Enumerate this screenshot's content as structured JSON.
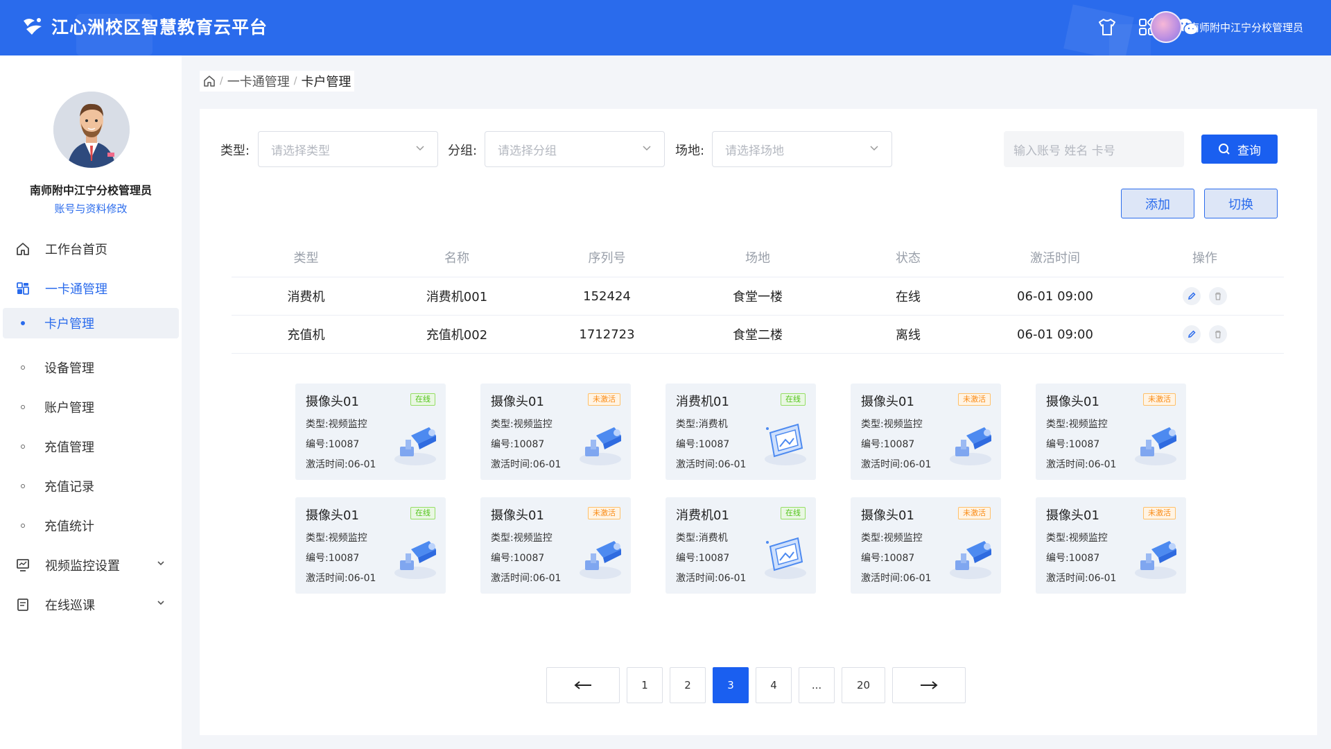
{
  "app": {
    "title": "江心洲校区智慧教育云平台"
  },
  "header": {
    "icons": [
      "tshirt-icon",
      "apps-grid-icon",
      "wechat-icon"
    ],
    "user_name": "南师附中江宁分校管理员"
  },
  "sidebar": {
    "profile_name": "南师附中江宁分校管理员",
    "profile_link": "账号与资料修改",
    "menu": [
      {
        "label": "工作台首页",
        "icon": "home-icon"
      },
      {
        "label": "一卡通管理",
        "icon": "dashboard-icon"
      },
      {
        "label": "卡户管理"
      },
      {
        "label": "设备管理"
      },
      {
        "label": "账户管理"
      },
      {
        "label": "充值管理"
      },
      {
        "label": "充值记录"
      },
      {
        "label": "充值统计"
      },
      {
        "label": "视频监控设置",
        "icon": "monitor-icon"
      },
      {
        "label": "在线巡课",
        "icon": "document-icon"
      }
    ]
  },
  "breadcrumb": {
    "items": [
      "一卡通管理",
      "卡户管理"
    ],
    "sep": "/"
  },
  "filters": {
    "type_label": "类型:",
    "type_placeholder": "请选择类型",
    "group_label": "分组:",
    "group_placeholder": "请选择分组",
    "venue_label": "场地:",
    "venue_placeholder": "请选择场地",
    "search_placeholder": "输入账号 姓名 卡号",
    "query_label": "查询",
    "add_label": "添加",
    "switch_label": "切换"
  },
  "table": {
    "columns": [
      "类型",
      "名称",
      "序列号",
      "场地",
      "状态",
      "激活时间",
      "操作"
    ],
    "rows": [
      [
        "消费机",
        "消费机001",
        "152424",
        "食堂一楼",
        "在线",
        "06-01 09:00"
      ],
      [
        "充值机",
        "充值机002",
        "1712723",
        "食堂二楼",
        "离线",
        "06-01 09:00"
      ]
    ]
  },
  "cards": [
    {
      "title": "摄像头01",
      "status": "在线",
      "status_kind": "online",
      "type": "类型:视频监控",
      "code": "编号:10087",
      "time": "激活时间:06-01",
      "illus": "camera"
    },
    {
      "title": "摄像头01",
      "status": "未激活",
      "status_kind": "inactive",
      "type": "类型:视频监控",
      "code": "编号:10087",
      "time": "激活时间:06-01",
      "illus": "camera"
    },
    {
      "title": "消费机01",
      "status": "在线",
      "status_kind": "online",
      "type": "类型:消费机",
      "code": "编号:10087",
      "time": "激活时间:06-01",
      "illus": "screen"
    },
    {
      "title": "摄像头01",
      "status": "未激活",
      "status_kind": "inactive",
      "type": "类型:视频监控",
      "code": "编号:10087",
      "time": "激活时间:06-01",
      "illus": "camera"
    },
    {
      "title": "摄像头01",
      "status": "未激活",
      "status_kind": "inactive",
      "type": "类型:视频监控",
      "code": "编号:10087",
      "time": "激活时间:06-01",
      "illus": "camera"
    },
    {
      "title": "摄像头01",
      "status": "在线",
      "status_kind": "online",
      "type": "类型:视频监控",
      "code": "编号:10087",
      "time": "激活时间:06-01",
      "illus": "camera"
    },
    {
      "title": "摄像头01",
      "status": "未激活",
      "status_kind": "inactive",
      "type": "类型:视频监控",
      "code": "编号:10087",
      "time": "激活时间:06-01",
      "illus": "camera"
    },
    {
      "title": "消费机01",
      "status": "在线",
      "status_kind": "online",
      "type": "类型:消费机",
      "code": "编号:10087",
      "time": "激活时间:06-01",
      "illus": "screen"
    },
    {
      "title": "摄像头01",
      "status": "未激活",
      "status_kind": "inactive",
      "type": "类型:视频监控",
      "code": "编号:10087",
      "time": "激活时间:06-01",
      "illus": "camera"
    },
    {
      "title": "摄像头01",
      "status": "未激活",
      "status_kind": "inactive",
      "type": "类型:视频监控",
      "code": "编号:10087",
      "time": "激活时间:06-01",
      "illus": "camera"
    }
  ],
  "pagination": {
    "pages": [
      "1",
      "2",
      "3",
      "4",
      "...",
      "20"
    ],
    "current": "3",
    "prev": "←",
    "next": "→"
  },
  "colors": {
    "primary": "#2a6bec",
    "online": "#52c41a",
    "inactive": "#fa8c16"
  }
}
